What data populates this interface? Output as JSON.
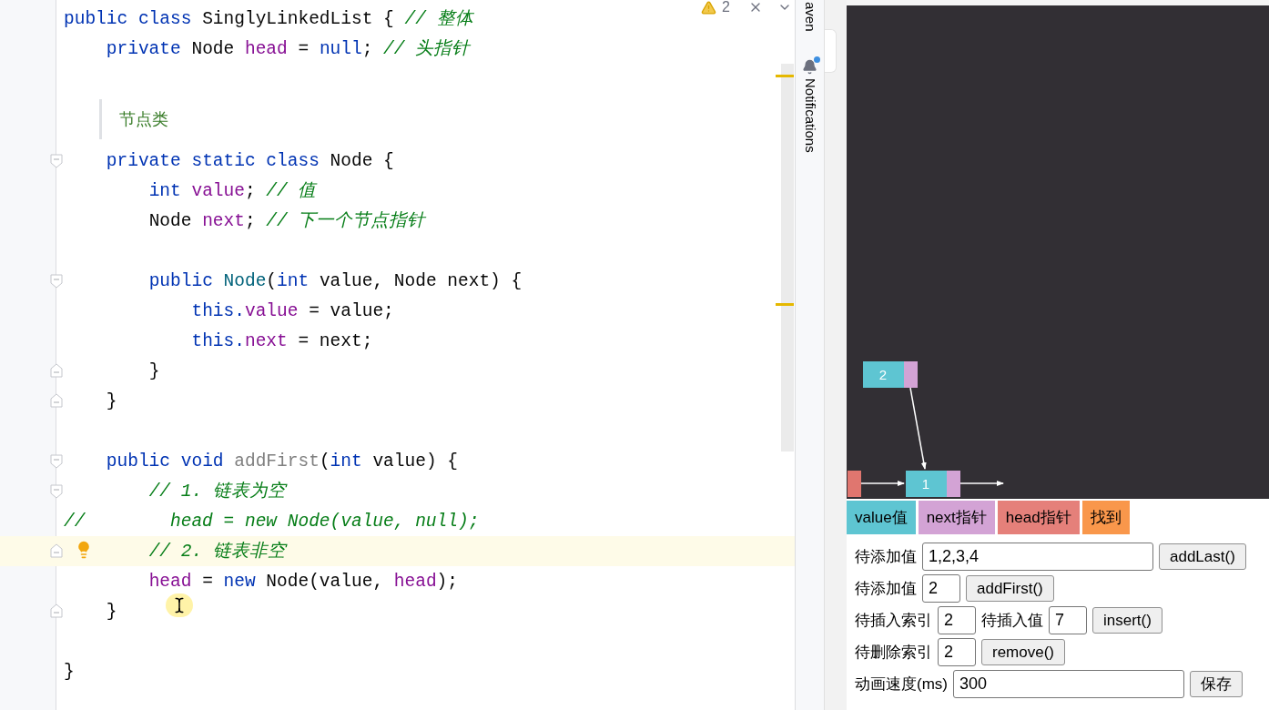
{
  "editor": {
    "problems": {
      "count": "2"
    },
    "lines": [
      {
        "kind": "code",
        "fold_start": false,
        "fold_end": false,
        "highlighted": false,
        "bulb": false,
        "tokens": [
          {
            "text": "public class ",
            "kind": "keyword"
          },
          {
            "text": "SinglyLinkedList { ",
            "kind": "plain"
          },
          {
            "text": "// 整体",
            "kind": "comment"
          }
        ]
      },
      {
        "kind": "code",
        "fold_start": false,
        "fold_end": false,
        "highlighted": false,
        "bulb": false,
        "tokens": [
          {
            "text": "    private ",
            "kind": "keyword"
          },
          {
            "text": "Node ",
            "kind": "plain"
          },
          {
            "text": "head",
            "kind": "field"
          },
          {
            "text": " = ",
            "kind": "plain"
          },
          {
            "text": "null",
            "kind": "keyword"
          },
          {
            "text": "; ",
            "kind": "plain"
          },
          {
            "text": "// 头指针",
            "kind": "comment"
          }
        ]
      },
      {
        "kind": "blank"
      },
      {
        "kind": "doc",
        "text": "节点类"
      },
      {
        "kind": "code",
        "fold_start": true,
        "fold_end": false,
        "highlighted": false,
        "bulb": false,
        "tokens": [
          {
            "text": "    private static class ",
            "kind": "keyword"
          },
          {
            "text": "Node {",
            "kind": "plain"
          }
        ]
      },
      {
        "kind": "code",
        "fold_start": false,
        "fold_end": false,
        "highlighted": false,
        "bulb": false,
        "tokens": [
          {
            "text": "        int ",
            "kind": "keyword"
          },
          {
            "text": "value",
            "kind": "field"
          },
          {
            "text": "; ",
            "kind": "plain"
          },
          {
            "text": "// 值",
            "kind": "comment"
          }
        ]
      },
      {
        "kind": "code",
        "fold_start": false,
        "fold_end": false,
        "highlighted": false,
        "bulb": false,
        "tokens": [
          {
            "text": "        Node ",
            "kind": "plain"
          },
          {
            "text": "next",
            "kind": "field"
          },
          {
            "text": "; ",
            "kind": "plain"
          },
          {
            "text": "// 下一个节点指针",
            "kind": "comment"
          }
        ]
      },
      {
        "kind": "blank"
      },
      {
        "kind": "code",
        "fold_start": true,
        "fold_end": false,
        "highlighted": false,
        "bulb": false,
        "tokens": [
          {
            "text": "        public ",
            "kind": "keyword"
          },
          {
            "text": "Node",
            "kind": "declaration"
          },
          {
            "text": "(",
            "kind": "plain"
          },
          {
            "text": "int ",
            "kind": "keyword"
          },
          {
            "text": "value, Node next) {",
            "kind": "plain"
          }
        ]
      },
      {
        "kind": "code",
        "fold_start": false,
        "fold_end": false,
        "highlighted": false,
        "bulb": false,
        "tokens": [
          {
            "text": "            this.",
            "kind": "keyword"
          },
          {
            "text": "value",
            "kind": "field"
          },
          {
            "text": " = value;",
            "kind": "plain"
          }
        ]
      },
      {
        "kind": "code",
        "fold_start": false,
        "fold_end": false,
        "highlighted": false,
        "bulb": false,
        "tokens": [
          {
            "text": "            this.",
            "kind": "keyword"
          },
          {
            "text": "next",
            "kind": "field"
          },
          {
            "text": " = next;",
            "kind": "plain"
          }
        ]
      },
      {
        "kind": "code",
        "fold_start": false,
        "fold_end": true,
        "highlighted": false,
        "bulb": false,
        "tokens": [
          {
            "text": "        }",
            "kind": "plain"
          }
        ]
      },
      {
        "kind": "code",
        "fold_start": false,
        "fold_end": true,
        "highlighted": false,
        "bulb": false,
        "tokens": [
          {
            "text": "    }",
            "kind": "plain"
          }
        ]
      },
      {
        "kind": "blank"
      },
      {
        "kind": "code",
        "fold_start": true,
        "fold_end": false,
        "highlighted": false,
        "bulb": false,
        "tokens": [
          {
            "text": "    public void ",
            "kind": "keyword"
          },
          {
            "text": "addFirst",
            "kind": "unused"
          },
          {
            "text": "(",
            "kind": "plain"
          },
          {
            "text": "int ",
            "kind": "keyword"
          },
          {
            "text": "value) {",
            "kind": "plain"
          }
        ]
      },
      {
        "kind": "code",
        "fold_start": true,
        "fold_end": false,
        "highlighted": false,
        "bulb": false,
        "tokens": [
          {
            "text": "        // 1. 链表为空",
            "kind": "comment"
          }
        ]
      },
      {
        "kind": "code",
        "fold_start": false,
        "fold_end": false,
        "highlighted": false,
        "bulb": false,
        "tokens": [
          {
            "text": "//        head = new Node(value, null);",
            "kind": "comment"
          }
        ]
      },
      {
        "kind": "code",
        "fold_start": false,
        "fold_end": true,
        "highlighted": true,
        "bulb": true,
        "tokens": [
          {
            "text": "        // 2. 链表非空",
            "kind": "comment"
          }
        ]
      },
      {
        "kind": "code",
        "fold_start": false,
        "fold_end": false,
        "highlighted": false,
        "bulb": false,
        "tokens": [
          {
            "text": "        head",
            "kind": "field"
          },
          {
            "text": " = ",
            "kind": "plain"
          },
          {
            "text": "new ",
            "kind": "keyword"
          },
          {
            "text": "Node(value, ",
            "kind": "plain"
          },
          {
            "text": "head",
            "kind": "field"
          },
          {
            "text": ");",
            "kind": "plain"
          }
        ]
      },
      {
        "kind": "code",
        "fold_start": false,
        "fold_end": true,
        "highlighted": false,
        "bulb": false,
        "tokens": [
          {
            "text": "    }",
            "kind": "plain"
          }
        ]
      },
      {
        "kind": "blank"
      },
      {
        "kind": "code",
        "fold_start": false,
        "fold_end": false,
        "highlighted": false,
        "bulb": false,
        "tokens": [
          {
            "text": "}",
            "kind": "plain"
          }
        ]
      }
    ]
  },
  "tool_strip": {
    "items": [
      {
        "label": "aven",
        "kind": "text"
      },
      {
        "label": "Notifications",
        "kind": "notifications",
        "unread": true
      }
    ]
  },
  "visualizer": {
    "diagram": {
      "nodes": [
        {
          "value": "2",
          "kind": "pending"
        },
        {
          "value": "1",
          "kind": "linked"
        }
      ]
    },
    "legend": [
      {
        "label": "value值",
        "color": "#5ec5d2"
      },
      {
        "label": "next指针",
        "color": "#d3a3d5"
      },
      {
        "label": "head指针",
        "color": "#e5807a"
      },
      {
        "label": "找到",
        "color": "#f9974b"
      }
    ],
    "controls": [
      [
        {
          "kind": "label",
          "text": "待添加值"
        },
        {
          "kind": "wide-field",
          "value": "1,2,3,4"
        },
        {
          "kind": "button",
          "text": "addLast()"
        }
      ],
      [
        {
          "kind": "label",
          "text": "待添加值"
        },
        {
          "kind": "field",
          "value": "2"
        },
        {
          "kind": "button",
          "text": "addFirst()"
        }
      ],
      [
        {
          "kind": "label",
          "text": "待插入索引"
        },
        {
          "kind": "field",
          "value": "2"
        },
        {
          "kind": "label",
          "text": "待插入值"
        },
        {
          "kind": "field",
          "value": "7"
        },
        {
          "kind": "button",
          "text": "insert()"
        }
      ],
      [
        {
          "kind": "label",
          "text": "待删除索引"
        },
        {
          "kind": "field",
          "value": "2"
        },
        {
          "kind": "button",
          "text": "remove()"
        }
      ],
      [
        {
          "kind": "label",
          "text": "动画速度(ms)"
        },
        {
          "kind": "wide-field",
          "value": "300"
        },
        {
          "kind": "button",
          "text": "保存"
        }
      ]
    ]
  }
}
